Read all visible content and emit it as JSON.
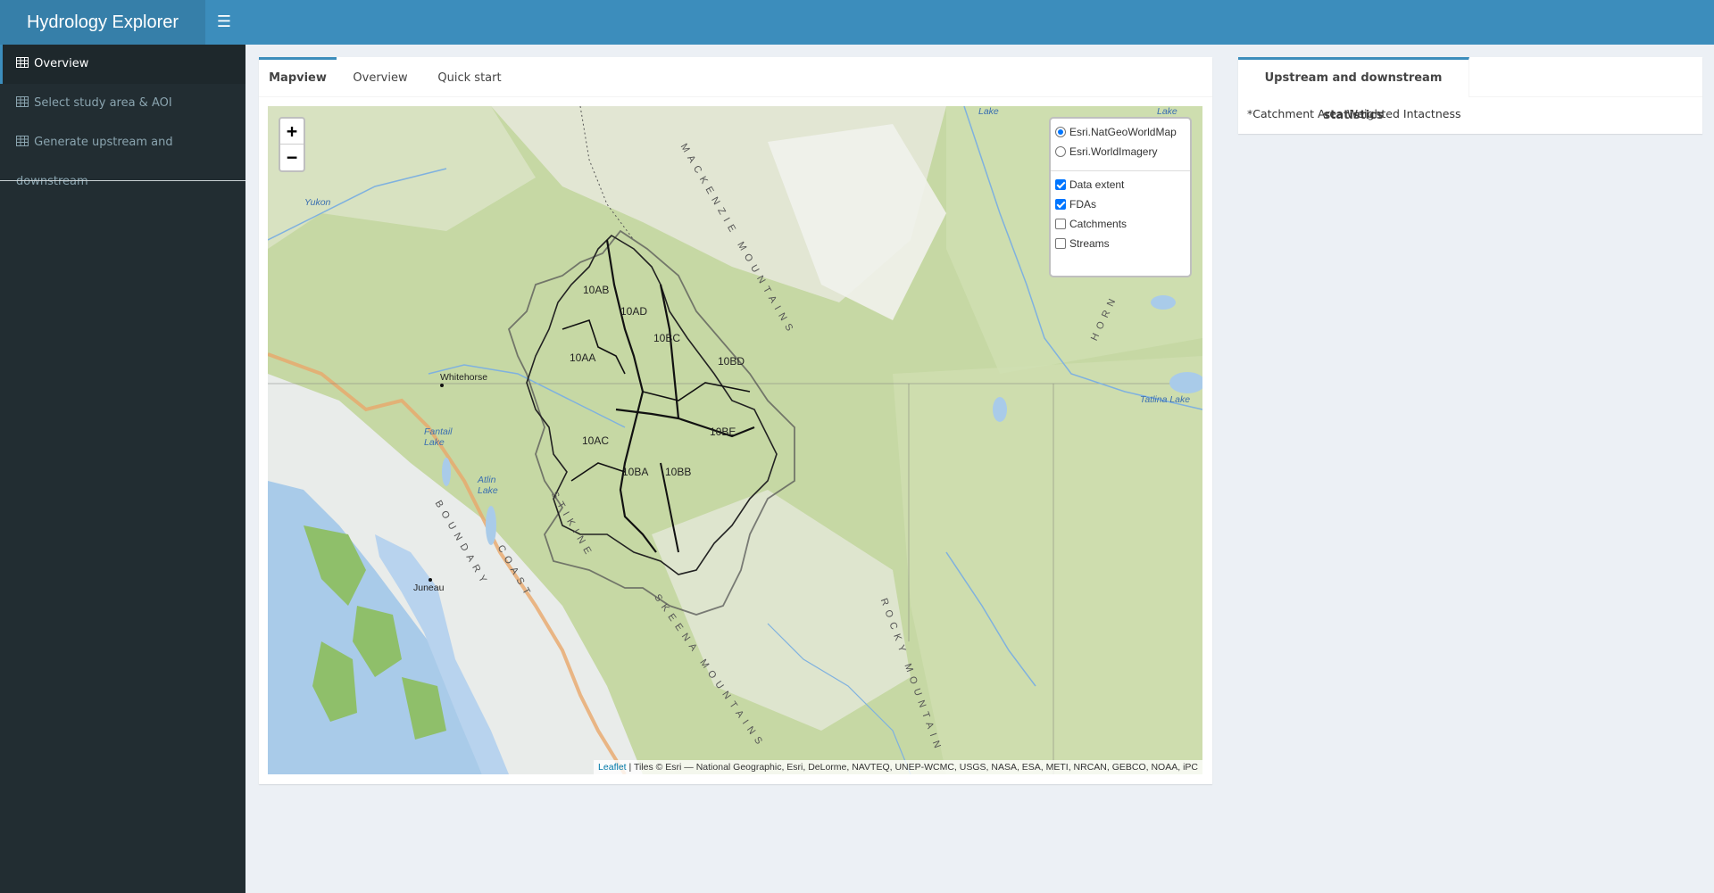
{
  "app": {
    "title": "Hydrology Explorer"
  },
  "header": {
    "toggle_icon": "☰"
  },
  "sidebar": {
    "items": [
      {
        "label": "Overview",
        "icon": "table-icon",
        "active": true
      },
      {
        "label": "Select study area & AOI",
        "icon": "table-icon",
        "active": false
      },
      {
        "label": "Generate upstream and downstream",
        "icon": "table-icon",
        "active": false
      }
    ]
  },
  "main": {
    "tabs": [
      {
        "label": "Mapview",
        "active": true
      },
      {
        "label": "Overview",
        "active": false
      },
      {
        "label": "Quick start",
        "active": false
      }
    ],
    "map": {
      "zoom_in": "+",
      "zoom_out": "−",
      "basemaps": [
        {
          "label": "Esri.NatGeoWorldMap",
          "selected": true
        },
        {
          "label": "Esri.WorldImagery",
          "selected": false
        }
      ],
      "overlays": [
        {
          "label": "Data extent",
          "checked": true
        },
        {
          "label": "FDAs",
          "checked": true
        },
        {
          "label": "Catchments",
          "checked": false
        },
        {
          "label": "Streams",
          "checked": false
        }
      ],
      "attribution_link": "Leaflet",
      "attribution_text": " | Tiles © Esri — National Geographic, Esri, DeLorme, NAVTEQ, UNEP-WCMC, USGS, NASA, ESA, METI, NRCAN, GEBCO, NOAA, iPC",
      "fda_labels": [
        "10AB",
        "10AD",
        "10BC",
        "10AA",
        "10BD",
        "10AC",
        "10BE",
        "10BA",
        "10BB"
      ],
      "places": [
        "Whitehorse",
        "Juneau"
      ],
      "water_labels": [
        "Yukon",
        "Lake",
        "Lake",
        "Tatlina Lake",
        "Fantail Lake",
        "Atlin Lake"
      ],
      "range_labels": [
        "MACKENZIE MOUNTAINS",
        "STIKINE",
        "BOUNDARY",
        "COAST",
        "SKEENA MOUNTAINS",
        "ROCKY MOUNTAIN",
        "HORN"
      ]
    }
  },
  "stats": {
    "tab_label": "Upstream and downstream statistics",
    "note": "*Catchment Area Weighted Intactness"
  }
}
